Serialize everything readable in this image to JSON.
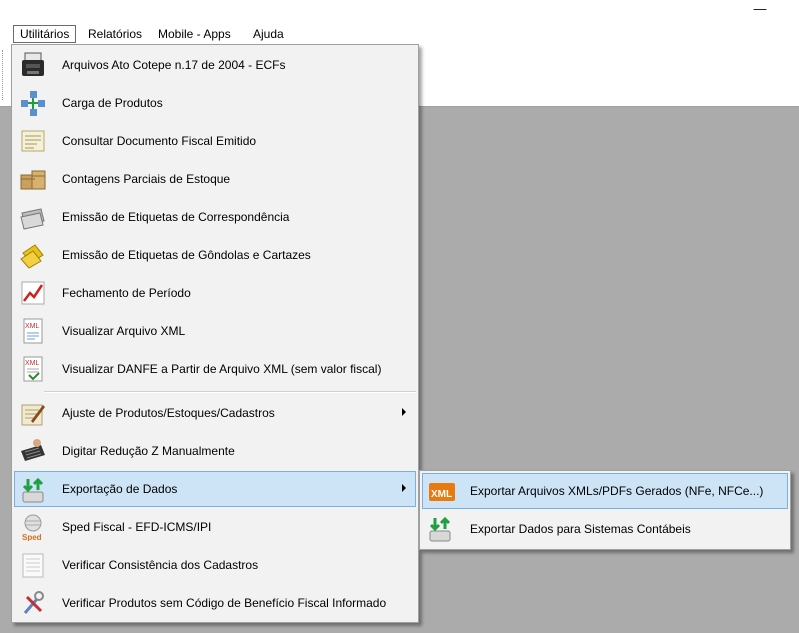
{
  "window": {
    "minimize_glyph": "—"
  },
  "menubar": {
    "items": [
      {
        "label": "Utilitários",
        "active": true
      },
      {
        "label": "Relatórios"
      },
      {
        "label": "Mobile - Apps"
      },
      {
        "label": "Ajuda"
      }
    ]
  },
  "menu": {
    "items": [
      {
        "label": "Arquivos Ato Cotepe n.17 de 2004 - ECFs",
        "icon": "ecf-printer-icon"
      },
      {
        "label": "Carga de Produtos",
        "icon": "network-transfer-icon"
      },
      {
        "label": "Consultar Documento Fiscal Emitido",
        "icon": "document-icon"
      },
      {
        "label": "Contagens Parciais de Estoque",
        "icon": "boxes-icon"
      },
      {
        "label": "Emissão de Etiquetas de Correspondência",
        "icon": "envelopes-icon"
      },
      {
        "label": "Emissão de Etiquetas de Gôndolas e Cartazes",
        "icon": "tags-icon"
      },
      {
        "label": "Fechamento de Período",
        "icon": "chart-icon"
      },
      {
        "label": "Visualizar Arquivo XML",
        "icon": "xml-file-icon"
      },
      {
        "label": "Visualizar DANFE a Partir de Arquivo XML (sem valor fiscal)",
        "icon": "xml-danfe-icon"
      },
      {
        "label": "Ajuste de Produtos/Estoques/Cadastros",
        "icon": "pen-paper-icon",
        "submenu": true
      },
      {
        "label": "Digitar Redução Z Manualmente",
        "icon": "keyboard-icon"
      },
      {
        "label": "Exportação de Dados",
        "icon": "export-icon",
        "submenu": true,
        "highlighted": true
      },
      {
        "label": "Sped Fiscal - EFD-ICMS/IPI",
        "icon": "sped-icon",
        "icon_text": "Sped"
      },
      {
        "label": "Verificar Consistência dos Cadastros",
        "icon": "checklist-icon"
      },
      {
        "label": "Verificar Produtos sem Código de Benefício Fiscal Informado",
        "icon": "tools-icon"
      }
    ]
  },
  "submenu": {
    "items": [
      {
        "label": "Exportar Arquivos XMLs/PDFs Gerados (NFe, NFCe...)",
        "icon": "xml-export-icon",
        "icon_text": "XML",
        "highlighted": true
      },
      {
        "label": "Exportar Dados para Sistemas Contábeis",
        "icon": "database-export-icon"
      }
    ]
  },
  "colors": {
    "highlight_bg": "#cde4f7",
    "highlight_border": "#79b0e0",
    "menu_bg": "#f2f2f2",
    "workspace_bg": "#ababab"
  }
}
